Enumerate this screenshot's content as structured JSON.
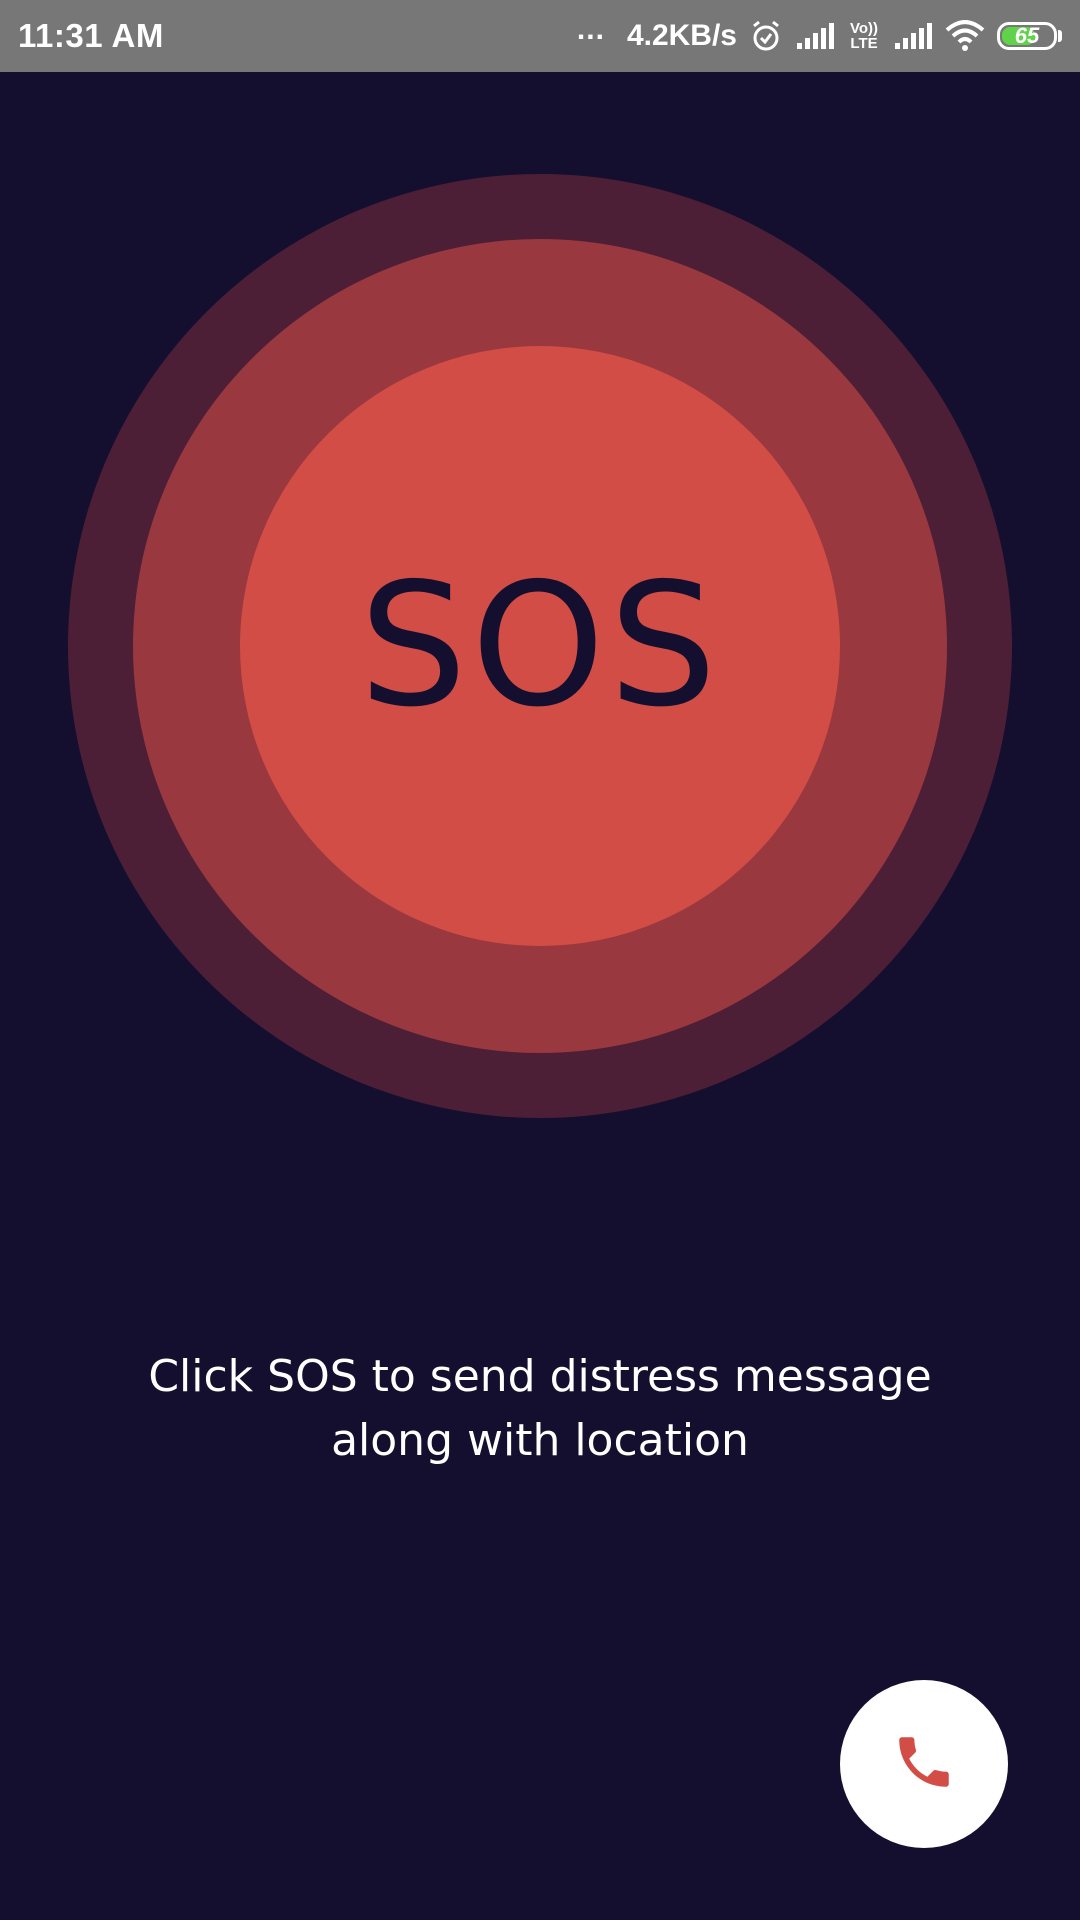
{
  "status_bar": {
    "time": "11:31 AM",
    "dots": "...",
    "network_speed": "4.2KB/s",
    "volte_label_top": "Vo))",
    "volte_label_bottom": "LTE",
    "battery_level": "65",
    "battery_fraction": 0.65,
    "icons": [
      "more-dots-icon",
      "alarm-icon",
      "signal-icon",
      "volte-icon",
      "signal-icon",
      "wifi-icon",
      "battery-icon"
    ]
  },
  "sos": {
    "label": "SOS"
  },
  "instruction": {
    "line1": "Click SOS to send distress message",
    "line2": "along with location"
  },
  "call_button": {
    "icon": "phone-icon"
  },
  "colors": {
    "background": "#150f2f",
    "status_bar": "#777777",
    "ring_outer": "#4d1f37",
    "ring_middle": "#9a383f",
    "sos_core": "#d24d46",
    "accent_red": "#d24d46",
    "battery_green": "#61d34a"
  }
}
